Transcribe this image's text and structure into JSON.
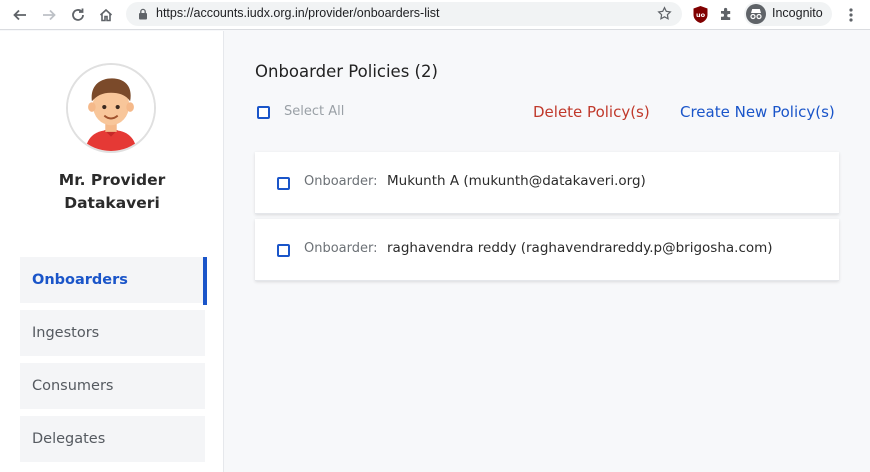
{
  "browser": {
    "url": "https://accounts.iudx.org.in/provider/onboarders-list",
    "incognito_label": "Incognito"
  },
  "sidebar": {
    "profile_name_line1": "Mr. Provider",
    "profile_name_line2": "Datakaveri",
    "items": [
      {
        "label": "Onboarders",
        "active": true
      },
      {
        "label": "Ingestors",
        "active": false
      },
      {
        "label": "Consumers",
        "active": false
      },
      {
        "label": "Delegates",
        "active": false
      }
    ]
  },
  "main": {
    "title": "Onboarder Policies (2)",
    "select_all_label": "Select All",
    "delete_label": "Delete Policy(s)",
    "create_label": "Create New Policy(s)",
    "policies": [
      {
        "label": "Onboarder:",
        "value": "Mukunth A (mukunth@datakaveri.org)"
      },
      {
        "label": "Onboarder:",
        "value": "raghavendra reddy (raghavendrareddy.p@brigosha.com)"
      }
    ]
  },
  "colors": {
    "accent": "#1a55c9",
    "danger": "#c0392b",
    "sidebar_item_bg": "#f4f5f7",
    "page_bg": "#f7f8fa"
  },
  "icons": [
    "back-arrow-icon",
    "forward-arrow-icon",
    "reload-icon",
    "home-icon",
    "lock-icon",
    "star-icon",
    "ublock-icon",
    "puzzle-icon",
    "incognito-icon",
    "more-vert-icon",
    "avatar"
  ]
}
